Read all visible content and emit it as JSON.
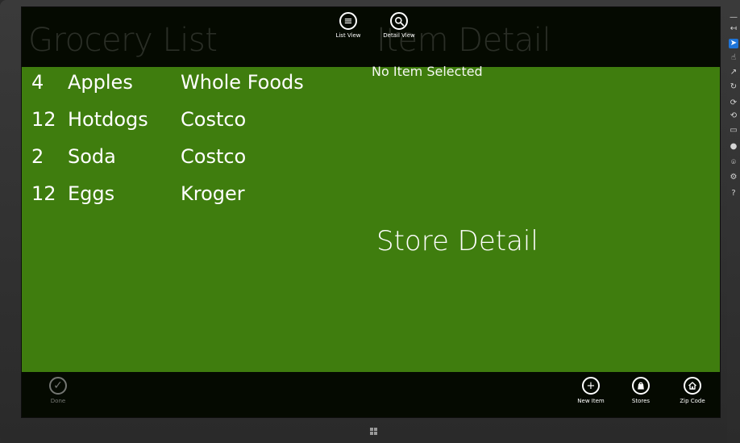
{
  "topbar": {
    "title_left": "Grocery List",
    "title_right": "Item Detail",
    "list_view_label": "List View",
    "detail_view_label": "Detail View"
  },
  "list": {
    "rows": [
      {
        "qty": "4",
        "item": "Apples",
        "store": "Whole Foods"
      },
      {
        "qty": "12",
        "item": "Hotdogs",
        "store": "Costco"
      },
      {
        "qty": "2",
        "item": "Soda",
        "store": "Costco"
      },
      {
        "qty": "12",
        "item": "Eggs",
        "store": "Kroger"
      }
    ]
  },
  "detail": {
    "no_item_text": "No Item Selected",
    "store_detail_text": "Store Detail"
  },
  "bottombar": {
    "done_label": "Done",
    "new_item_label": "New Item",
    "stores_label": "Stores",
    "zip_code_label": "Zip Code"
  },
  "colors": {
    "app_background": "#3f7d0e",
    "bar_background": "#000000",
    "text": "#ffffff",
    "rail_active": "#1e74d8"
  },
  "icons": {
    "list_view": "list-icon",
    "detail_view": "search-icon",
    "done": "check-icon",
    "new_item": "plus-icon",
    "stores": "bag-icon",
    "zip_code": "home-icon",
    "windows": "windows-logo-icon"
  }
}
